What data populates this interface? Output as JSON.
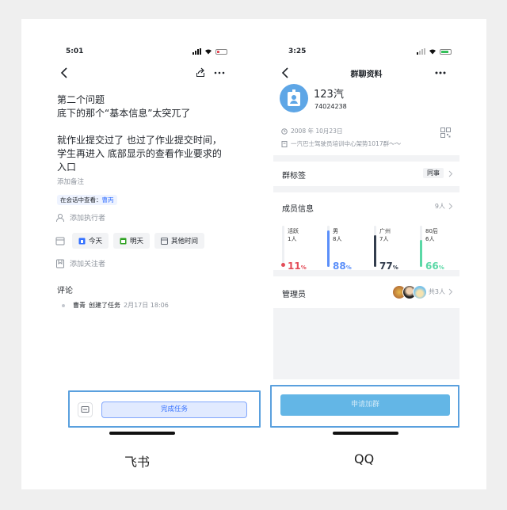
{
  "left": {
    "status_time": "5:01",
    "title_lines": [
      "第二个问题",
      "底下的那个“基本信息”太突兀了",
      "",
      "就作业提交过了 也过了作业提交时间，",
      "学生再进入 底部显示的查看作业要求的",
      "入口"
    ],
    "add_note": "添加备注",
    "view_in_chat_prefix": "在会话中查看：",
    "view_in_chat_link": "曹丙",
    "add_assignee": "添加执行者",
    "date_today": "今天",
    "date_tomorrow": "明天",
    "date_other": "其他时间",
    "add_follower": "添加关注者",
    "comments_heading": "评论",
    "comment_user": "曹青",
    "comment_action": "创建了任务",
    "comment_time": "2月17日 18:06",
    "complete_button": "完成任务",
    "caption": "飞书"
  },
  "right": {
    "status_time": "3:25",
    "page_title": "群聊资料",
    "group_name": "123汽",
    "group_id": "74024238",
    "created_date": "2008 年 10月23日",
    "group_desc": "一汽巴士驾驶员培训中心架势1017群～～",
    "group_tag_label": "群标签",
    "group_tag_value": "同事",
    "members_label": "成员信息",
    "members_count": "9人",
    "stats": [
      {
        "name": "活跃",
        "count": "1人",
        "pct": "11",
        "value": 11,
        "color": "#e34d59"
      },
      {
        "name": "男",
        "count": "8人",
        "pct": "88",
        "value": 88,
        "color": "#5b8ff9"
      },
      {
        "name": "广州",
        "count": "7人",
        "pct": "77",
        "value": 77,
        "color": "#333d4d"
      },
      {
        "name": "80后",
        "count": "6人",
        "pct": "66",
        "value": 66,
        "color": "#5ad8a6"
      }
    ],
    "pct_sign": "%",
    "admins_label": "管理员",
    "admins_count": "共3人",
    "join_button": "申请加群",
    "caption": "QQ"
  }
}
